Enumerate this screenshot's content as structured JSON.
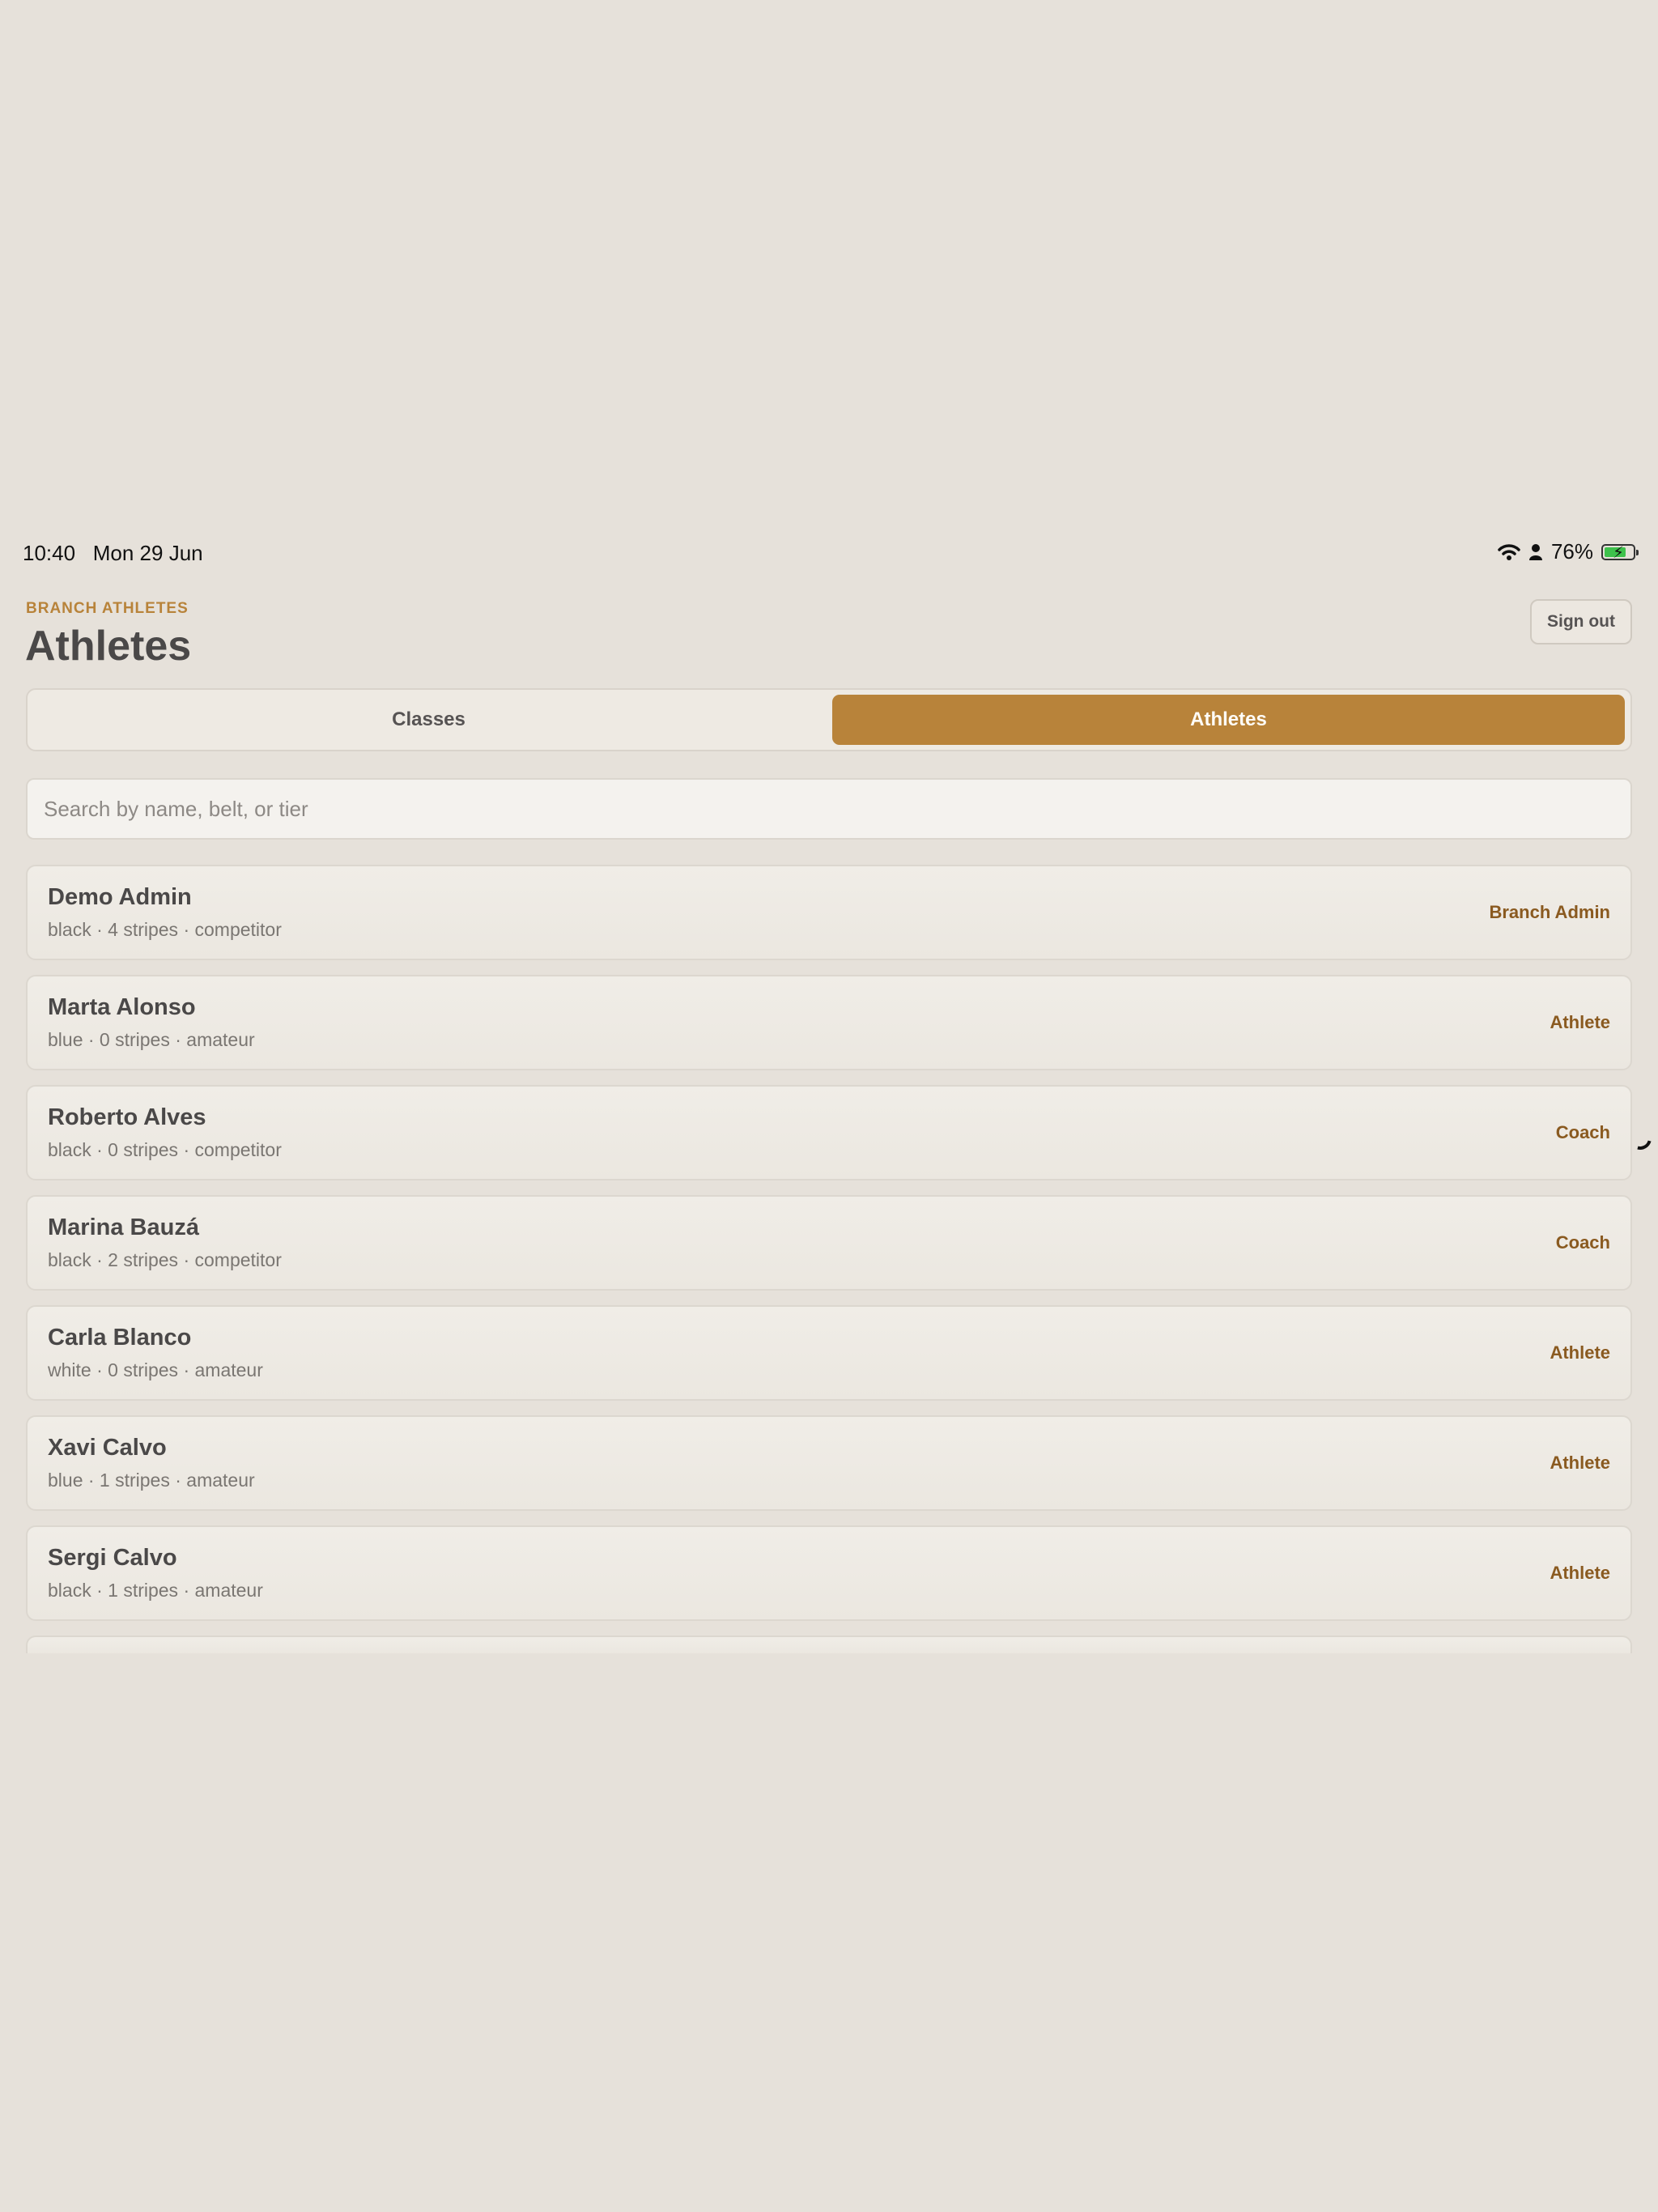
{
  "status_bar": {
    "time": "10:40",
    "date": "Mon 29 Jun",
    "battery": "76%",
    "battery_level": 0.76,
    "icons": [
      "wifi-icon",
      "person-icon",
      "battery-charging-icon"
    ]
  },
  "header": {
    "eyebrow": "BRANCH ATHLETES",
    "title": "Athletes",
    "sign_out": "Sign out"
  },
  "tabs": [
    {
      "label": "Classes",
      "selected": false
    },
    {
      "label": "Athletes",
      "selected": true
    }
  ],
  "search": {
    "placeholder": "Search by name, belt, or tier",
    "value": ""
  },
  "athletes": [
    {
      "name": "Demo Admin",
      "detail": "black · 4 stripes · competitor",
      "role": "Branch Admin"
    },
    {
      "name": "Marta Alonso",
      "detail": "blue · 0 stripes · amateur",
      "role": "Athlete"
    },
    {
      "name": "Roberto Alves",
      "detail": "black · 0 stripes · competitor",
      "role": "Coach"
    },
    {
      "name": "Marina Bauzá",
      "detail": "black · 2 stripes · competitor",
      "role": "Coach"
    },
    {
      "name": "Carla Blanco",
      "detail": "white · 0 stripes · amateur",
      "role": "Athlete"
    },
    {
      "name": "Xavi Calvo",
      "detail": "blue · 1 stripes · amateur",
      "role": "Athlete"
    },
    {
      "name": "Sergi Calvo",
      "detail": "black · 1 stripes · amateur",
      "role": "Athlete"
    }
  ],
  "colors": {
    "accent": "#b8833a",
    "role_text": "#8a5a20",
    "background": "#e6e1da"
  }
}
